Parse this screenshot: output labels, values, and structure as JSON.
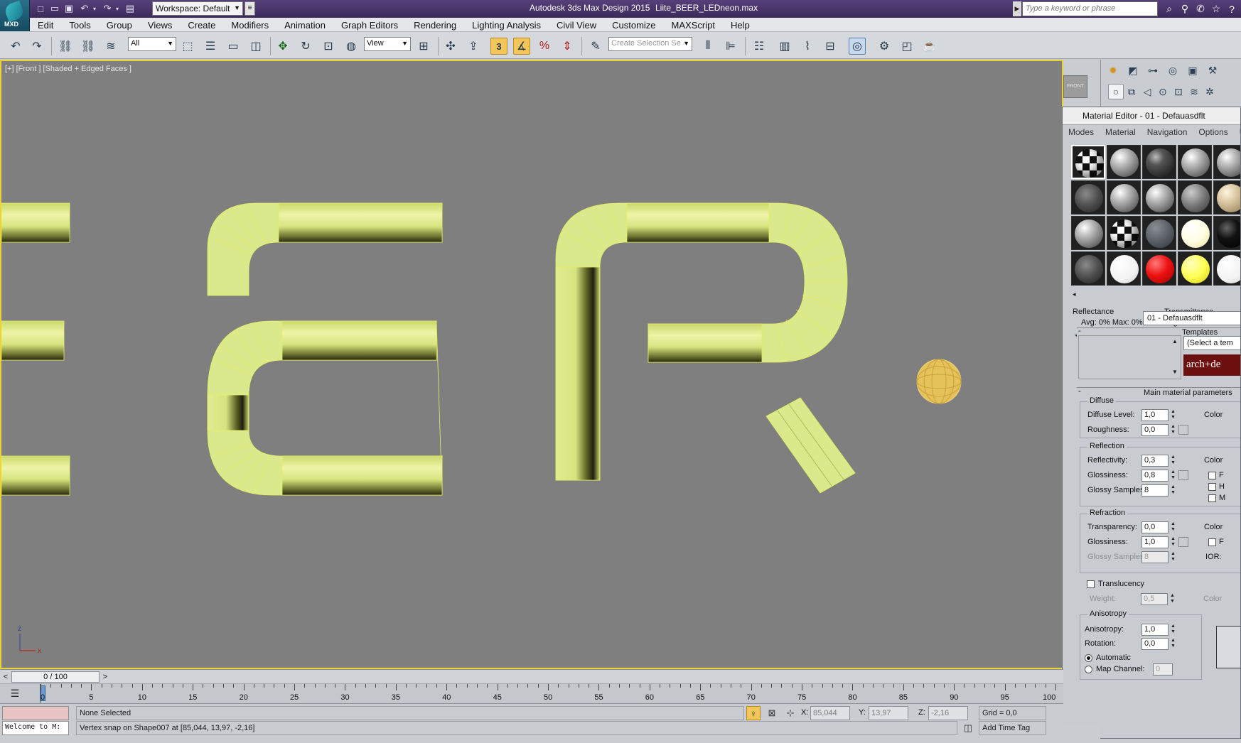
{
  "titlebar": {
    "app_logo_label": "MXD",
    "workspace": "Workspace: Default",
    "app_title": "Autodesk 3ds Max Design 2015",
    "document": "Liite_BEER_LEDneon.max",
    "search_placeholder": "Type a keyword or phrase"
  },
  "menubar": [
    "Edit",
    "Tools",
    "Group",
    "Views",
    "Create",
    "Modifiers",
    "Animation",
    "Graph Editors",
    "Rendering",
    "Lighting Analysis",
    "Civil View",
    "Customize",
    "MAXScript",
    "Help"
  ],
  "toolbar": {
    "selection_filter": "All",
    "reference_coord": "View",
    "snap_label": "3",
    "named_selection_placeholder": "Create Selection Se"
  },
  "viewport": {
    "label": "[+] [Front ] [Shaded + Edged Faces ]",
    "viewcube_label": "FRONT",
    "axis_z": "z",
    "axis_x": "x"
  },
  "material_editor": {
    "title": "Material Editor - 01 - Defauasdflt",
    "menu": [
      "Modes",
      "Material",
      "Navigation",
      "Options",
      "Utilities"
    ],
    "reflectance_label": "Reflectance",
    "reflectance_values": "Avg:  0% Max:  0%",
    "transmittance_label": "Transmittance",
    "transmittance_values": "Avg:  0% Max:",
    "material_name": "01 - Defauasdflt",
    "templates_label": "Templates",
    "templates_select": "(Select a tem",
    "arch_label": "arch+de",
    "main_params_title": "Main material parameters",
    "diffuse": {
      "title": "Diffuse",
      "level_label": "Diffuse Level:",
      "level": "1,0",
      "roughness_label": "Roughness:",
      "roughness": "0,0",
      "color_label": "Color"
    },
    "reflection": {
      "title": "Reflection",
      "reflectivity_label": "Reflectivity:",
      "reflectivity": "0,3",
      "glossiness_label": "Glossiness:",
      "glossiness": "0,8",
      "samples_label": "Glossy Samples:",
      "samples": "8",
      "color_label": "Color",
      "c1": "F",
      "c2": "H",
      "c3": "M"
    },
    "refraction": {
      "title": "Refraction",
      "transparency_label": "Transparency:",
      "transparency": "0,0",
      "glossiness_label": "Glossiness:",
      "glossiness": "1,0",
      "samples_label": "Glossy Samples:",
      "samples": "8",
      "color_label": "Color",
      "c1": "F",
      "ior_label": "IOR:"
    },
    "translucency": {
      "label": "Translucency",
      "weight_label": "Weight:",
      "weight": "0,5",
      "color_label": "Color"
    },
    "anisotropy": {
      "title": "Anisotropy",
      "aniso_label": "Anisotropy:",
      "aniso": "1,0",
      "rotation_label": "Rotation:",
      "rotation": "0,0",
      "automatic": "Automatic",
      "map_channel": "Map Channel:",
      "map_channel_value": "0"
    }
  },
  "timeline": {
    "frame_display": "0 / 100",
    "prev": "<",
    "next": ">",
    "labels": [
      "0",
      "5",
      "10",
      "15",
      "20",
      "25",
      "30",
      "35",
      "40",
      "45",
      "50",
      "55",
      "60",
      "65",
      "70",
      "75",
      "80",
      "85",
      "90",
      "95",
      "100"
    ]
  },
  "status": {
    "welcome": "Welcome to M:",
    "selection": "None Selected",
    "prompt": "Vertex snap on Shape007 at [85,044, 13,97, -2,16]",
    "x_label": "X:",
    "x": "85,044",
    "y_label": "Y:",
    "y": "13,97",
    "z_label": "Z:",
    "z": "-2,16",
    "grid": "Grid = 0,0",
    "add_time_tag": "Add Time Tag"
  },
  "colors": {
    "viewport_bg": "#7f7f7f",
    "tube_fill": "#d9e98c",
    "tube_edge": "#e6ec5a",
    "active_border": "#e8d438",
    "title_bar": "#4a3468"
  }
}
